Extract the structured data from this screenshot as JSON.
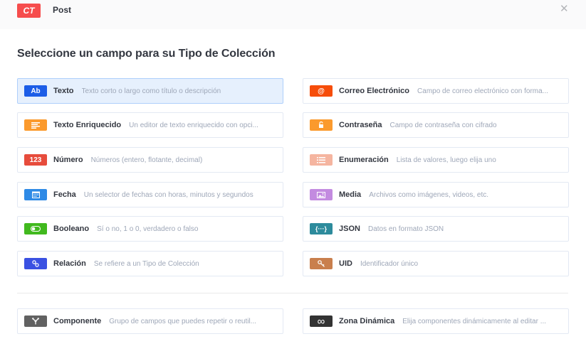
{
  "header": {
    "badge": "CT",
    "title": "Post",
    "close_glyph": "✕"
  },
  "page_title": "Seleccione un campo para su Tipo de Colección",
  "fields": [
    {
      "name": "Texto",
      "description": "Texto corto o largo como título o descripción",
      "icon": "text-icon",
      "icon_label": "Ab",
      "color": "#1c5de7",
      "selected": true
    },
    {
      "name": "Correo Electrónico",
      "description": "Campo de correo electrónico con forma...",
      "icon": "email-icon",
      "icon_label": "@",
      "color": "#f64d0a"
    },
    {
      "name": "Texto Enriquecido",
      "description": "Un editor de texto enriquecido con opci...",
      "icon": "richtext-icon",
      "icon_label": "",
      "color": "#fb9a2d"
    },
    {
      "name": "Contraseña",
      "description": "Campo de contraseña con cifrado",
      "icon": "lock-icon",
      "icon_label": "",
      "color": "#fb9a2d"
    },
    {
      "name": "Número",
      "description": "Números (entero, flotante, decimal)",
      "icon": "number-icon",
      "icon_label": "123",
      "color": "#e74c3c"
    },
    {
      "name": "Enumeración",
      "description": "Lista de valores, luego elija uno",
      "icon": "list-icon",
      "icon_label": "",
      "color": "#f5b5a0"
    },
    {
      "name": "Fecha",
      "description": "Un selector de fechas con horas, minutos y segundos",
      "icon": "calendar-icon",
      "icon_label": "",
      "color": "#2e8ae6"
    },
    {
      "name": "Media",
      "description": "Archivos como imágenes, videos, etc.",
      "icon": "image-icon",
      "icon_label": "",
      "color": "#c38be0"
    },
    {
      "name": "Booleano",
      "description": "Sí o no, 1 o 0, verdadero o falso",
      "icon": "toggle-icon",
      "icon_label": "",
      "color": "#41b91e"
    },
    {
      "name": "JSON",
      "description": "Datos en formato JSON",
      "icon": "braces-icon",
      "icon_label": "{···}",
      "color": "#2d8b9c"
    },
    {
      "name": "Relación",
      "description": "Se refiere a un Tipo de Colección",
      "icon": "link-icon",
      "icon_label": "",
      "color": "#3a51e2"
    },
    {
      "name": "UID",
      "description": "Identificador único",
      "icon": "key-icon",
      "icon_label": "",
      "color": "#c97f4d"
    },
    {
      "name": "Componente",
      "description": "Grupo de campos que puedes repetir o reutil...",
      "icon": "component-icon",
      "icon_label": "",
      "color": "#616161"
    },
    {
      "name": "Zona Dinámica",
      "description": "Elija componentes dinámicamente al editar ...",
      "icon": "infinity-icon",
      "icon_label": "∞",
      "color": "#333333"
    }
  ]
}
